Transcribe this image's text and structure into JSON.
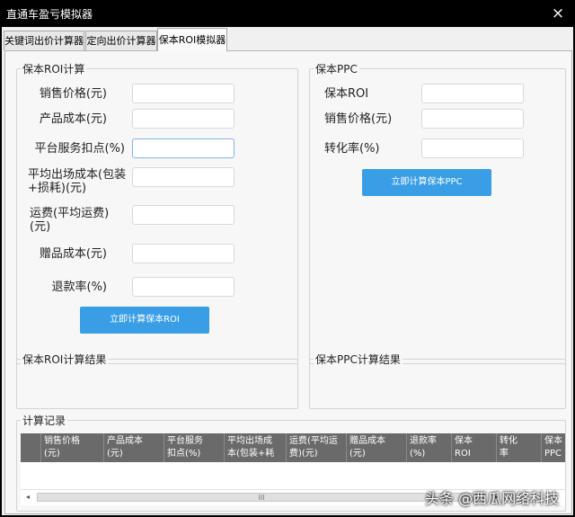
{
  "window": {
    "title": "直通车盈亏模拟器",
    "close_glyph": "×"
  },
  "tabs": [
    {
      "label": "关键词出价计算器"
    },
    {
      "label": "定向出价计算器"
    },
    {
      "label": "保本ROI模拟器"
    }
  ],
  "roi_group": {
    "title": "保本ROI计算",
    "fields": [
      {
        "label": "销售价格(元)"
      },
      {
        "label": "产品成本(元)"
      },
      {
        "label": "平台服务扣点(%)"
      },
      {
        "label": "平均出场成本(包装+损耗)(元)"
      },
      {
        "label": "运费(平均运费)(元)"
      },
      {
        "label": "赠品成本(元)"
      },
      {
        "label": "退款率(%)"
      }
    ],
    "button": "立即计算保本ROI"
  },
  "ppc_group": {
    "title": "保本PPC",
    "fields": [
      {
        "label": "保本ROI"
      },
      {
        "label": "销售价格(元)"
      },
      {
        "label": "转化率(%)"
      }
    ],
    "button": "立即计算保本PPC"
  },
  "roi_result": {
    "title": "保本ROI计算结果"
  },
  "ppc_result": {
    "title": "保本PPC计算结果"
  },
  "records": {
    "title": "计算记录",
    "columns": [
      "销售价格\n(元)",
      "产品成本\n(元)",
      "平台服务\n扣点(%)",
      "平均出场成\n本(包装+耗",
      "运费(平均运\n费)(元)",
      "赠品成本\n(元)",
      "退款率\n(%)",
      "保本\nROI",
      "转化\n率",
      "保本\nPPC"
    ],
    "scroll_left": "◂",
    "scroll_thumb": "III",
    "scroll_right": "▸"
  },
  "watermark": "头条 @西瓜网络科技"
}
